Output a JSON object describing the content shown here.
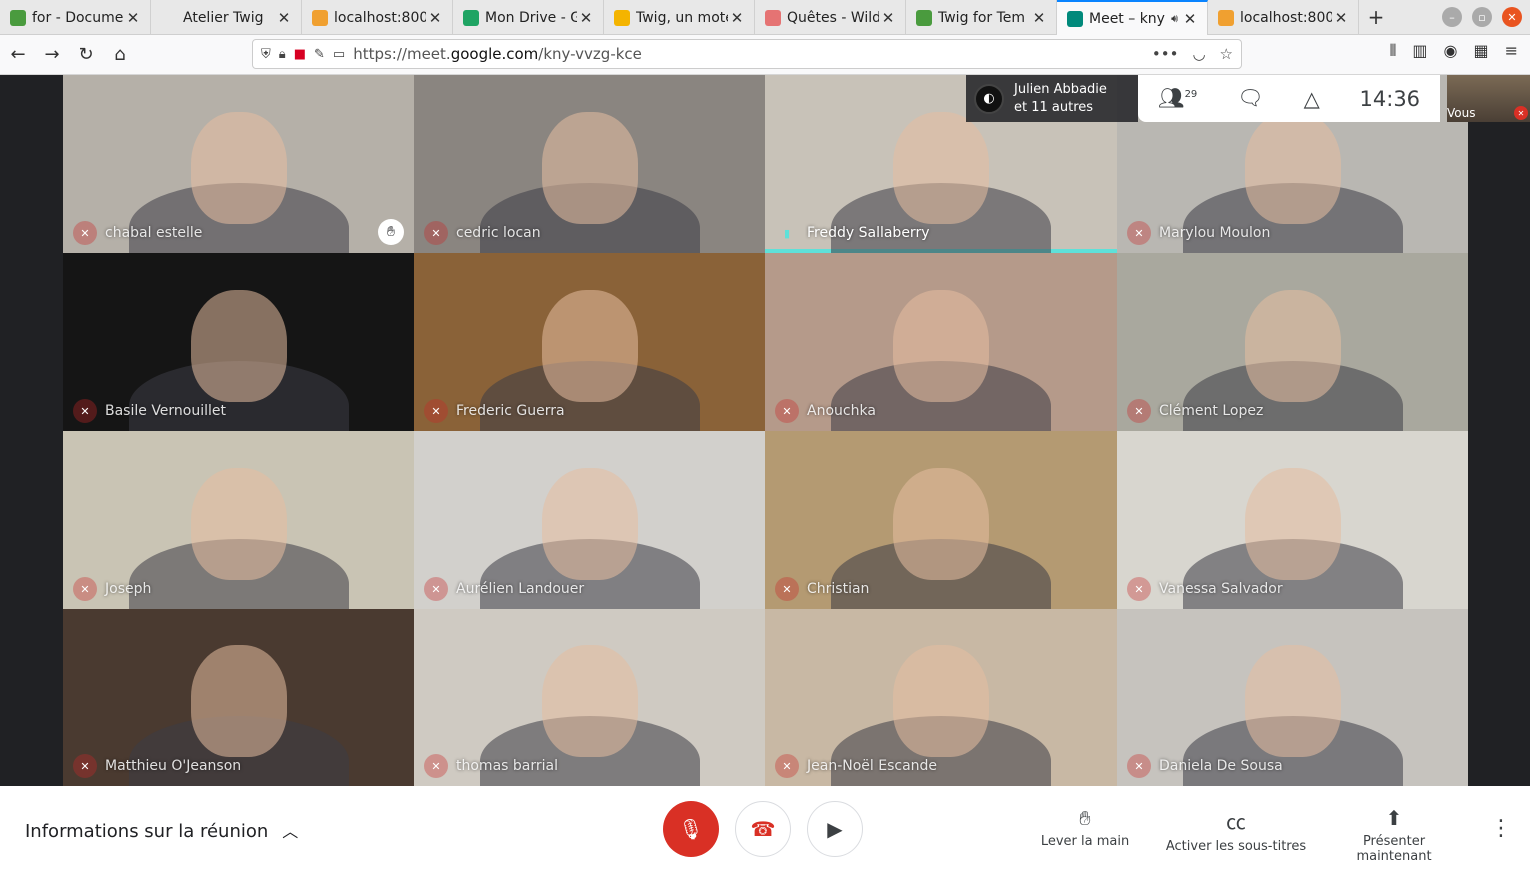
{
  "browser": {
    "tabs": [
      {
        "title": "for - Documer",
        "icon": "document-icon",
        "color": "#4a9b3e",
        "active": false
      },
      {
        "title": "Atelier Twig",
        "icon": "none",
        "color": "#e8e8e8",
        "active": false
      },
      {
        "title": "localhost:800",
        "icon": "symfony-icon",
        "color": "#f0a030",
        "active": false
      },
      {
        "title": "Mon Drive - G",
        "icon": "google-drive-icon",
        "color": "#1fa463",
        "active": false
      },
      {
        "title": "Twig, un mote",
        "icon": "slides-icon",
        "color": "#f4b400",
        "active": false
      },
      {
        "title": "Quêtes - Wild",
        "icon": "wild-icon",
        "color": "#e57373",
        "active": false
      },
      {
        "title": "Twig for Tem",
        "icon": "document-icon",
        "color": "#4a9b3e",
        "active": false
      },
      {
        "title": "Meet – kny",
        "icon": "meet-icon",
        "color": "#00897b",
        "active": true,
        "audio": true
      },
      {
        "title": "localhost:800",
        "icon": "symfony-icon",
        "color": "#f0a030",
        "active": false
      }
    ],
    "url_prefix": "https://meet.",
    "url_domain": "google.com",
    "url_path": "/kny-vvzg-kce"
  },
  "meet": {
    "presenting": {
      "line1": "Julien Abbadie",
      "line2": "et 11 autres"
    },
    "participant_count": "29",
    "clock": "14:36",
    "self_label": "Vous",
    "tiles": [
      {
        "name": "chabal estelle",
        "bg": "#b5b0a8",
        "hand": true
      },
      {
        "name": "cedric locan",
        "bg": "#8a8580"
      },
      {
        "name": "Freddy Sallaberry",
        "bg": "#c8c2b8",
        "speaking": true
      },
      {
        "name": "Marylou Moulon",
        "bg": "#b9b7b2"
      },
      {
        "name": "Basile Vernouillet",
        "bg": "#151515"
      },
      {
        "name": "Frederic Guerra",
        "bg": "#8a6238"
      },
      {
        "name": "Anouchka",
        "bg": "#b59a8a"
      },
      {
        "name": "Clément Lopez",
        "bg": "#a9a89e"
      },
      {
        "name": "Joseph",
        "bg": "#c9c4b4"
      },
      {
        "name": "Aurélien Landouer",
        "bg": "#d2d0cc"
      },
      {
        "name": "Christian",
        "bg": "#b49a72"
      },
      {
        "name": "Vanessa Salvador",
        "bg": "#d8d6cf"
      },
      {
        "name": "Matthieu O'Jeanson",
        "bg": "#4a3a30"
      },
      {
        "name": "thomas barrial",
        "bg": "#cfcac2"
      },
      {
        "name": "Jean-Noël Escande",
        "bg": "#c8b8a4"
      },
      {
        "name": "Daniela De Sousa",
        "bg": "#c6c3be"
      }
    ]
  },
  "bottom": {
    "meeting_info": "Informations sur la réunion",
    "raise_hand": "Lever la main",
    "captions": "Activer les sous-titres",
    "present": "Présenter maintenant"
  }
}
